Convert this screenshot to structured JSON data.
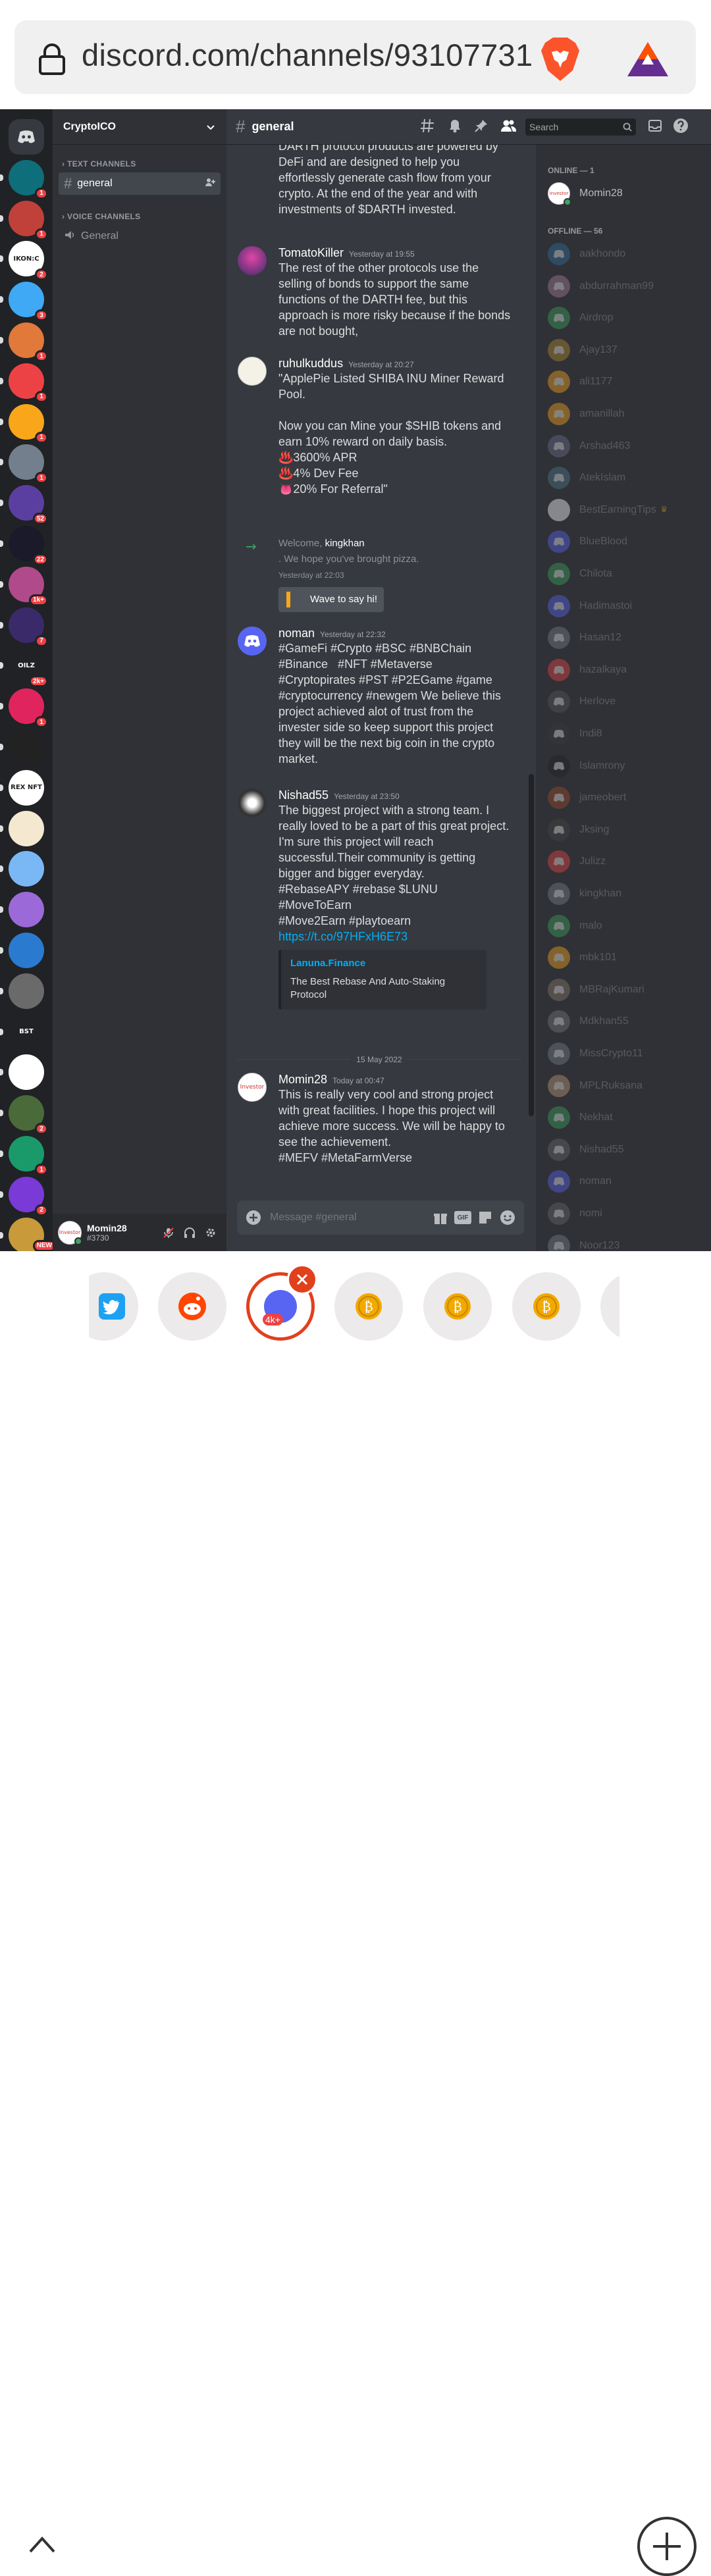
{
  "browser": {
    "url": "discord.com/channels/93107731",
    "tabs": {
      "count_badge": "4k+"
    }
  },
  "servers": [
    {
      "name": "home",
      "badge": ""
    },
    {
      "name": "alien-server",
      "badge": "1"
    },
    {
      "name": "girl-server",
      "badge": "1"
    },
    {
      "name": "ikonic-server",
      "badge": "2",
      "label": "IKON:C"
    },
    {
      "name": "blue-face-server",
      "badge": "3"
    },
    {
      "name": "panda-server",
      "badge": "1"
    },
    {
      "name": "red-discord-server",
      "badge": "1"
    },
    {
      "name": "orange-discord-server",
      "badge": "1"
    },
    {
      "name": "gray-discord-server",
      "badge": "1"
    },
    {
      "name": "purple-crypto-server",
      "badge": "52"
    },
    {
      "name": "dark-stripe-server",
      "badge": "22"
    },
    {
      "name": "pink-swirl-server",
      "badge": "1k+"
    },
    {
      "name": "game-server",
      "badge": "7"
    },
    {
      "name": "oilz-server",
      "badge": "2k+",
      "label": "OILZ"
    },
    {
      "name": "s-logo-server",
      "badge": "1"
    },
    {
      "name": "k-logo-server",
      "badge": ""
    },
    {
      "name": "rex-nft-server",
      "badge": "",
      "label": "REX NFT"
    },
    {
      "name": "coin-server",
      "badge": ""
    },
    {
      "name": "cloud-server",
      "badge": ""
    },
    {
      "name": "purple-ring-server",
      "badge": ""
    },
    {
      "name": "earth-server",
      "badge": ""
    },
    {
      "name": "mosaic-server",
      "badge": ""
    },
    {
      "name": "bst-server",
      "badge": "",
      "label": "BST"
    },
    {
      "name": "bird-server",
      "badge": ""
    },
    {
      "name": "dragon-server",
      "badge": "2"
    },
    {
      "name": "go-logo-server",
      "badge": "1"
    },
    {
      "name": "star-server",
      "badge": "2"
    },
    {
      "name": "new-server",
      "badge": "NEW"
    }
  ],
  "guild": {
    "name": "CryptoICO",
    "categories": [
      {
        "label": "TEXT CHANNELS",
        "channels": [
          {
            "name": "general"
          }
        ]
      },
      {
        "label": "VOICE CHANNELS",
        "channels": [
          {
            "name": "General"
          }
        ]
      }
    ]
  },
  "user": {
    "name": "Momin28",
    "tag": "#3730",
    "avatar_text": "Investor"
  },
  "chat": {
    "channel": "general",
    "search_placeholder": "Search",
    "composer_placeholder": "Message #general",
    "intro_text": "DARTH protocol products are powered by DeFi and are designed to help you effortlessly generate cash flow from your crypto. At the end of the year and with investments of $DARTH invested.",
    "messages": [
      {
        "author": "TomatoKiller",
        "time": "Yesterday at 19:55",
        "text": "The rest of the other protocols use the selling of bonds to support the same functions of the DARTH fee, but this approach is more risky because if the bonds are not bought,"
      },
      {
        "author": "ruhulkuddus",
        "time": "Yesterday at 20:27",
        "text": "\"ApplePie Listed SHIBA INU Miner Reward Pool.\n\nNow you can Mine your $SHIB tokens and earn 10% reward on daily basis.\n♨️3600% APR\n♨️4% Dev Fee\n👅20% For Referral\""
      },
      {
        "system": true,
        "welcome": "Welcome,",
        "user": "kingkhan",
        "text": ". We hope you've brought pizza.",
        "time": "Yesterday at 22:03",
        "button": "Wave to say hi!"
      },
      {
        "author": "noman",
        "time": "Yesterday at 22:32",
        "text": "#GameFi #Crypto #BSC #BNBChain #Binance   #NFT #Metaverse #Cryptopirates #PST #P2EGame #game #cryptocurrency #newgem We believe this project achieved alot of trust from the invester side so keep support this project they will be the next big coin in the crypto market."
      },
      {
        "author": "Nishad55",
        "time": "Yesterday at 23:50",
        "text": "The biggest project with a strong team. I really loved to be a part of this great project. I'm sure this project will reach successful.Their community is getting bigger and bigger everyday.\n#RebaseAPY #rebase $LUNU\n#MoveToEarn\n#Move2Earn #playtoearn",
        "link": "https://t.co/97HFxH6E73",
        "embed": {
          "provider": "Lanuna.Finance",
          "description": "The Best Rebase And Auto-Staking Protocol"
        }
      },
      {
        "divider": "15 May 2022"
      },
      {
        "author": "Momin28",
        "time": "Today at 00:47",
        "text": "This is really very cool and strong project with great facilities. I hope this project will achieve more success. We will be happy to see the achievement.\n#MEFV #MetaFarmVerse"
      }
    ]
  },
  "members": {
    "online_header": "ONLINE — 1",
    "offline_header": "OFFLINE — 56",
    "online": [
      "Momin28"
    ],
    "offline": [
      "aakhondo",
      "abdurrahman99",
      "Airdrop",
      "Ajay137",
      "ali1177",
      "amanillah",
      "Arshad463",
      "AtekIslam",
      "BestEarningTips",
      "BlueBlood",
      "Chilota",
      "Hadimastoi",
      "Hasan12",
      "hazalkaya",
      "Herlove",
      "Indi8",
      "Islamrony",
      "jameobert",
      "Jksing",
      "Julizz",
      "kingkhan",
      "malo",
      "mbk101",
      "MBRajKumari",
      "Mdkhan55",
      "MissCrypto11",
      "MPLRuksana",
      "Nekhat",
      "Nishad55",
      "noman",
      "nomi",
      "Noor123"
    ],
    "colors": [
      "#2f6f9e",
      "#a87d95",
      "#3ba55d",
      "#b38a2e",
      "#faa61a",
      "#faa61a",
      "#6b6b8a",
      "#4a7a8a",
      "#ffffff",
      "#5865f2",
      "#3ba55d",
      "#5865f2",
      "#747f8d",
      "#ed4245",
      "#555555",
      "#3a3a3a",
      "#222222",
      "#a04a2a",
      "#444444",
      "#ed4245",
      "#747f8d",
      "#3ba55d",
      "#faa61a",
      "#8a7a6a",
      "#777777",
      "#747f8d",
      "#c49a7a",
      "#3ba55d",
      "#666666",
      "#5865f2",
      "#666666",
      "#747f8d"
    ]
  },
  "colors": {
    "accent": "#5865f2",
    "badge": "#ed4245",
    "online": "#3ba55d",
    "link": "#00aff4"
  }
}
